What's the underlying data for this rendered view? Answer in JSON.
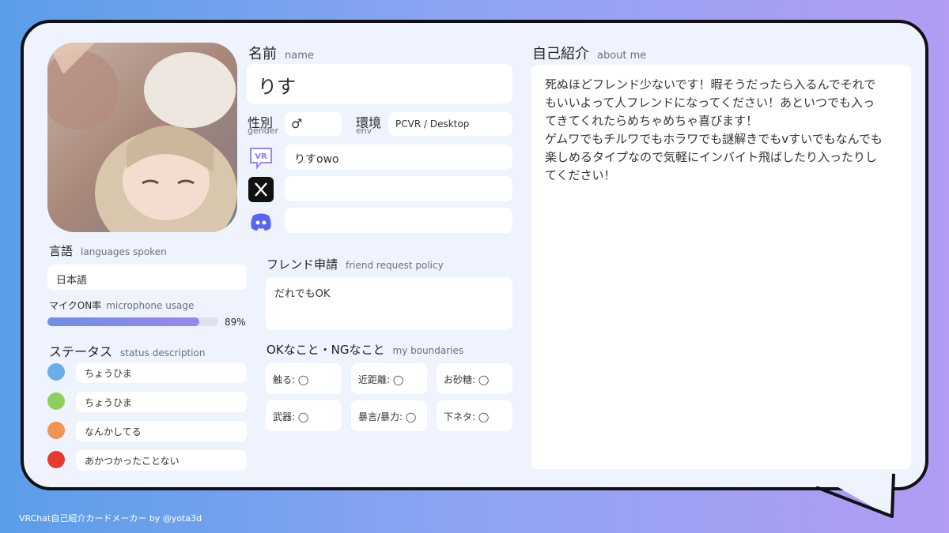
{
  "footer": "VRChat自己紹介カードメーカー by @yota3d",
  "name": {
    "title": "名前",
    "sub": "name",
    "value": "りす"
  },
  "gender": {
    "title": "性別",
    "sub": "gender",
    "value": "♂"
  },
  "env": {
    "title": "環境",
    "sub": "env",
    "value": "PCVR / Desktop"
  },
  "accounts": {
    "vrchat": {
      "icon": "vrchat-icon",
      "value": "りすowo"
    },
    "x": {
      "icon": "x-icon",
      "value": ""
    },
    "discord": {
      "icon": "discord-icon",
      "value": ""
    }
  },
  "languages": {
    "title": "言語",
    "sub": "languages spoken",
    "value": "日本語"
  },
  "mic": {
    "title": "マイクON率",
    "sub": "microphone usage",
    "percent_label": "89%",
    "fraction": 0.89
  },
  "status": {
    "title": "ステータス",
    "sub": "status description",
    "items": [
      {
        "color": "#6aaee8",
        "label": "ちょうひま"
      },
      {
        "color": "#8fd05c",
        "label": "ちょうひま"
      },
      {
        "color": "#ee9455",
        "label": "なんかしてる"
      },
      {
        "color": "#e8392f",
        "label": "あかつかったことない"
      }
    ]
  },
  "friend": {
    "title": "フレンド申請",
    "sub": "friend request policy",
    "value": "だれでもOK"
  },
  "boundaries": {
    "title": "OKなこと・NGなこと",
    "sub": "my boundaries",
    "items": [
      "触る: ◯",
      "近距離: ◯",
      "お砂糖: ◯",
      "武器: ◯",
      "暴言/暴力: ◯",
      "下ネタ: ◯"
    ]
  },
  "about": {
    "title": "自己紹介",
    "sub": "about me",
    "lines": [
      "死ぬほどフレンド少ないです！暇そうだったら入るんでそれで",
      "もいいよって人フレンドになってください！あといつでも入っ",
      "てきてくれたらめちゃめちゃ喜びます！",
      "ゲムワでもチルワでもホラワでも謎解きでもvすいでもなんでも",
      "楽しめるタイプなので気軽にインバイト飛ばしたり入ったりし",
      "てください！"
    ]
  }
}
